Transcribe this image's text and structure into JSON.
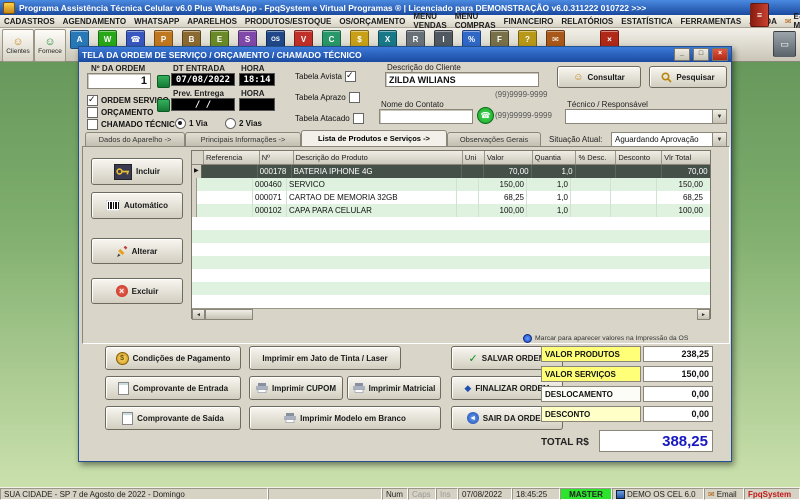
{
  "colors": {
    "desktop_green": "#7fae6e",
    "titlebar_blue": "#1a4aa0",
    "selected_row": "#445048",
    "value_label_yellow": "#ffff78",
    "total_blue": "#1818c0",
    "master_green": "#2ce42c"
  },
  "app": {
    "title": "Programa Assistência Técnica Celular v6.0 Plus WhatsApp - FpqSystem e Virtual Programas ® | Licenciado para  DEMONSTRAÇÃO v6.0.311222 010722 >>>",
    "menu": [
      "CADASTROS",
      "AGENDAMENTO",
      "WHATSAPP",
      "APARELHOS",
      "PRODUTOS/ESTOQUE",
      "OS/ORÇAMENTO",
      "MENU VENDAS",
      "MENU COMPRAS",
      "FINANCEIRO",
      "RELATÓRIOS",
      "ESTATÍSTICA",
      "FERRAMENTAS",
      "AJUDA",
      "E-MAIL"
    ]
  },
  "toolbar": {
    "clientes_label": "Clientes",
    "fornecedores_label": "Fornece",
    "icons": [
      {
        "name": "agenda-icon",
        "glyph": "A"
      },
      {
        "name": "whatsapp-icon",
        "glyph": "W"
      },
      {
        "name": "celular-icon",
        "glyph": "☎"
      },
      {
        "name": "aparelhos-icon",
        "glyph": "P"
      },
      {
        "name": "produtos-icon",
        "glyph": "B"
      },
      {
        "name": "estoque-icon",
        "glyph": "E"
      },
      {
        "name": "servicos-icon",
        "glyph": "S"
      },
      {
        "name": "ordem-servico-icon",
        "glyph": "OS"
      },
      {
        "name": "vendas-icon",
        "glyph": "V"
      },
      {
        "name": "compras-icon",
        "glyph": "C"
      },
      {
        "name": "financeiro-icon",
        "glyph": "$"
      },
      {
        "name": "caixa-icon",
        "glyph": "X"
      },
      {
        "name": "relatorios-icon",
        "glyph": "R"
      },
      {
        "name": "imprimir-icon",
        "glyph": "I"
      },
      {
        "name": "estatistica-icon",
        "glyph": "%"
      },
      {
        "name": "ferramentas-icon",
        "glyph": "F"
      },
      {
        "name": "ajuda-icon",
        "glyph": "?"
      },
      {
        "name": "email-icon",
        "glyph": "✉"
      },
      {
        "name": "sair-icon",
        "glyph": "×"
      }
    ]
  },
  "win": {
    "title": "TELA DA ORDEM DE SERVIÇO / ORÇAMENTO / CHAMADO TÉCNICO",
    "order": {
      "label": "Nº DA ORDEM",
      "value": "1"
    },
    "entry": {
      "dt_label": "DT ENTRADA",
      "dt_value": "07/08/2022",
      "hora_label": "HORA",
      "hora_value": "18:14",
      "prev_label": "Prev. Entrega",
      "prev_value": "/  /",
      "prev_hora_label": "HORA",
      "prev_hora_value": ""
    },
    "types": {
      "ordem": "ORDEM SERVIÇO",
      "orcamento": "ORÇAMENTO",
      "chamado": "CHAMADO TÉCNICO"
    },
    "vias": {
      "v1": "1 Via",
      "v2": "2 Vias"
    },
    "tabelas": {
      "avista": "Tabela Avista",
      "aprazo": "Tabela Aprazo",
      "atacado": "Tabela Atacado"
    },
    "cliente": {
      "label": "Descrição do Cliente",
      "value": "ZILDA WILIANS",
      "contato_label": "Nome do Contato",
      "contato_value": "",
      "phone1": "(99)9999-9999",
      "phone2": "(99)99999-9999"
    },
    "actions": {
      "consultar": "Consultar",
      "pesquisar": "Pesquisar"
    },
    "tecnico": {
      "label": "Técnico / Responsável",
      "value": ""
    },
    "tabs": [
      "Dados do Aparelho ->",
      "Principais Informações ->",
      "Lista de Produtos e Serviços ->",
      "Observações Gerais"
    ],
    "situacao": {
      "label": "Situação Atual:",
      "value": "Aguardando Aprovação"
    },
    "side": {
      "incluir": "Incluir",
      "automatico": "Automático",
      "alterar": "Alterar",
      "excluir": "Excluir"
    },
    "table": {
      "headers": [
        "Referencia",
        "Nº",
        "Descrição do Produto",
        "Uni",
        "Valor",
        "Quantia",
        "% Desc.",
        "Desconto",
        "Vlr Total"
      ],
      "rows": [
        {
          "ref": "",
          "num": "000178",
          "desc": "BATERIA IPHONE 4G",
          "uni": "",
          "valor": "70,00",
          "qt": "1,0",
          "pdesc": "",
          "desconto": "",
          "total": "70,00"
        },
        {
          "ref": "",
          "num": "000460",
          "desc": "SERVICO",
          "uni": "",
          "valor": "150,00",
          "qt": "1,0",
          "pdesc": "",
          "desconto": "",
          "total": "150,00"
        },
        {
          "ref": "",
          "num": "000071",
          "desc": "CARTAO DE MEMORIA 32GB",
          "uni": "",
          "valor": "68,25",
          "qt": "1,0",
          "pdesc": "",
          "desconto": "",
          "total": "68,25"
        },
        {
          "ref": "",
          "num": "000102",
          "desc": "CAPA PARA CELULAR",
          "uni": "",
          "valor": "100,00",
          "qt": "1,0",
          "pdesc": "",
          "desconto": "",
          "total": "100,00"
        }
      ]
    },
    "bottom": {
      "condicoes": "Condições de Pagamento",
      "comp_entrada": "Comprovante de Entrada",
      "comp_saida": "Comprovante de Saída",
      "jato": "Imprimir em Jato de Tinta / Laser",
      "cupom": "Imprimir CUPOM",
      "matricial": "Imprimir Matricial",
      "modelo": "Imprimir Modelo em Branco",
      "salvar": "SALVAR ORDEM",
      "finalizar": "FINALIZAR ORDEM",
      "sair": "SAIR DA ORDEM"
    },
    "totals": {
      "note": "Marcar para aparecer valores na Impressão da OS",
      "rows": [
        {
          "label": "VALOR PRODUTOS",
          "value": "238,25"
        },
        {
          "label": "VALOR SERVIÇOS",
          "value": "150,00"
        },
        {
          "label": "DESLOCAMENTO",
          "value": "0,00"
        },
        {
          "label": "DESCONTO",
          "value": "0,00"
        }
      ],
      "total_label": "TOTAL R$",
      "total_value": "388,25"
    }
  },
  "statusbar": {
    "location": "SUA CIDADE - SP  7 de Agosto de 2022 - Domingo",
    "num": "Num",
    "caps": "Caps",
    "ins": "Ins",
    "date": "07/08/2022",
    "time": "18:45:25",
    "user": "MASTER",
    "app": "DEMO OS CEL 6.0",
    "email": "Email",
    "brand": "FpqSystem"
  }
}
